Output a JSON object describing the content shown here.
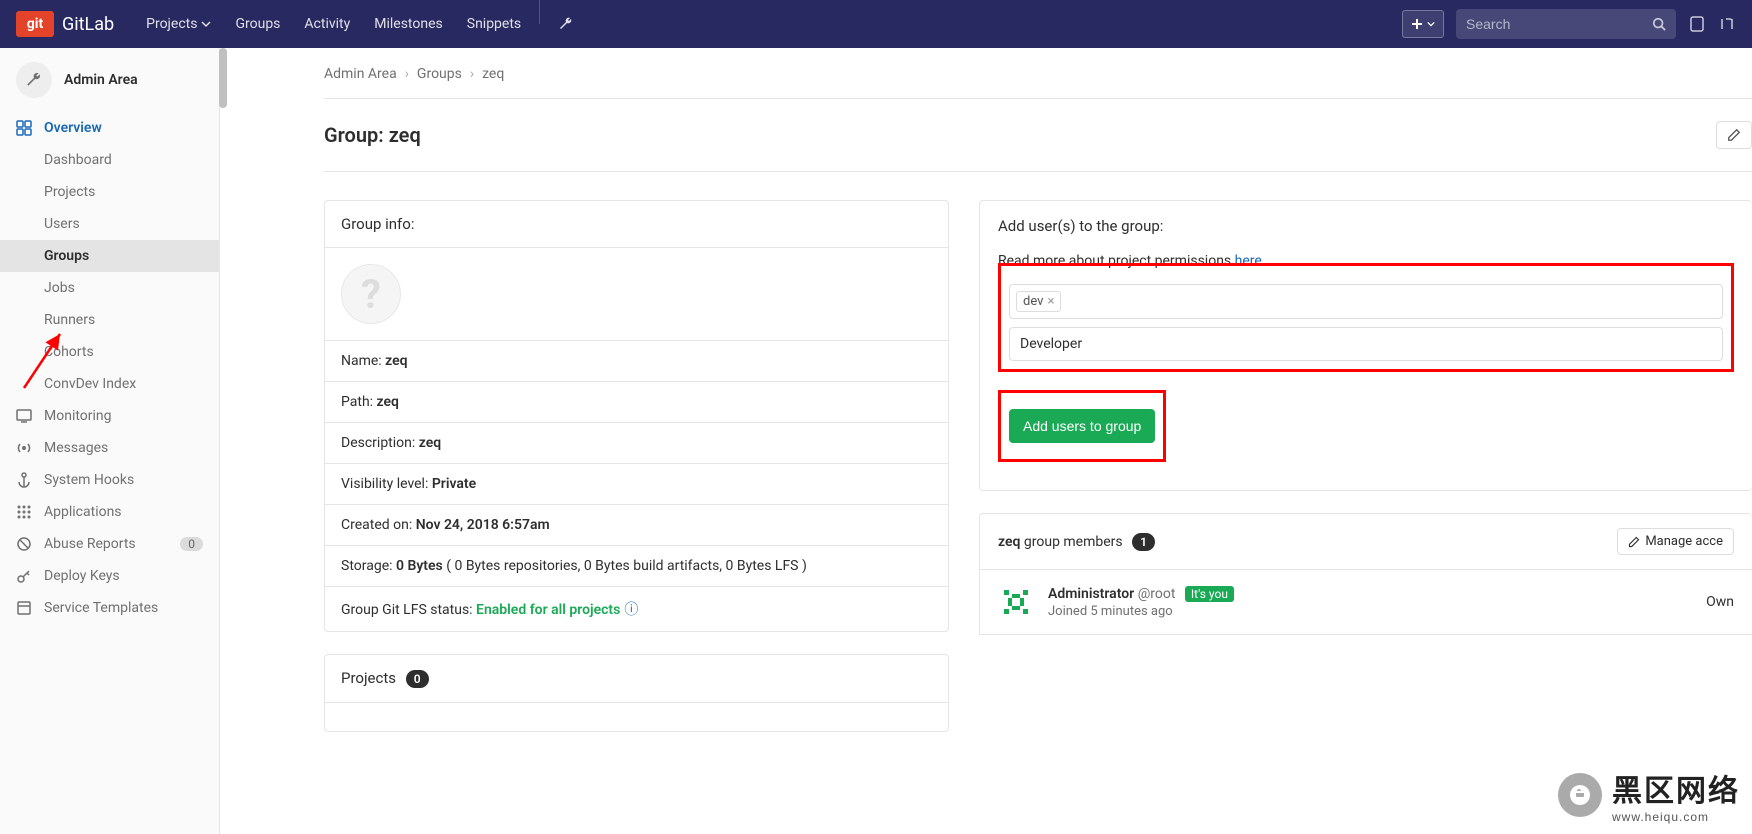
{
  "topnav": {
    "logo_badge": "git",
    "logo_text": "GitLab",
    "links": [
      "Projects",
      "Groups",
      "Activity",
      "Milestones",
      "Snippets"
    ],
    "search_placeholder": "Search"
  },
  "sidebar": {
    "header": "Admin Area",
    "overview_label": "Overview",
    "overview_items": [
      "Dashboard",
      "Projects",
      "Users",
      "Groups",
      "Jobs",
      "Runners",
      "Cohorts",
      "ConvDev Index"
    ],
    "overview_active": "Groups",
    "other_items": [
      {
        "label": "Monitoring",
        "icon": "monitor"
      },
      {
        "label": "Messages",
        "icon": "broadcast"
      },
      {
        "label": "System Hooks",
        "icon": "anchor"
      },
      {
        "label": "Applications",
        "icon": "apps"
      },
      {
        "label": "Abuse Reports",
        "icon": "abuse",
        "badge": "0"
      },
      {
        "label": "Deploy Keys",
        "icon": "key"
      },
      {
        "label": "Service Templates",
        "icon": "template"
      }
    ]
  },
  "breadcrumb": {
    "items": [
      "Admin Area",
      "Groups",
      "zeq"
    ]
  },
  "page": {
    "title_prefix": "Group: ",
    "title_name": "zeq"
  },
  "group_info": {
    "header": "Group info:",
    "name_label": "Name: ",
    "name_value": "zeq",
    "path_label": "Path: ",
    "path_value": "zeq",
    "desc_label": "Description: ",
    "desc_value": "zeq",
    "vis_label": "Visibility level: ",
    "vis_value": "Private",
    "created_label": "Created on: ",
    "created_value": "Nov 24, 2018 6:57am",
    "storage_label": "Storage: ",
    "storage_value": "0 Bytes",
    "storage_detail": " ( 0 Bytes repositories, 0 Bytes build artifacts, 0 Bytes LFS )",
    "lfs_label": "Group Git LFS status: ",
    "lfs_value": "Enabled for all projects"
  },
  "projects_panel": {
    "header": "Projects",
    "count": "0"
  },
  "add_users": {
    "header": "Add user(s) to the group:",
    "permissions_text": "Read more about project permissions ",
    "permissions_link": "here",
    "token": "dev",
    "role": "Developer",
    "button": "Add users to group"
  },
  "members": {
    "group_name": "zeq",
    "label": " group members ",
    "count": "1",
    "manage_label": "Manage acce",
    "member": {
      "name": "Administrator",
      "handle": "@root",
      "its_you": "It's you",
      "joined": "Joined 5 minutes ago",
      "role": "Own"
    }
  },
  "watermark": {
    "main": "黑区网络",
    "sub": "www.heiqu.com"
  }
}
